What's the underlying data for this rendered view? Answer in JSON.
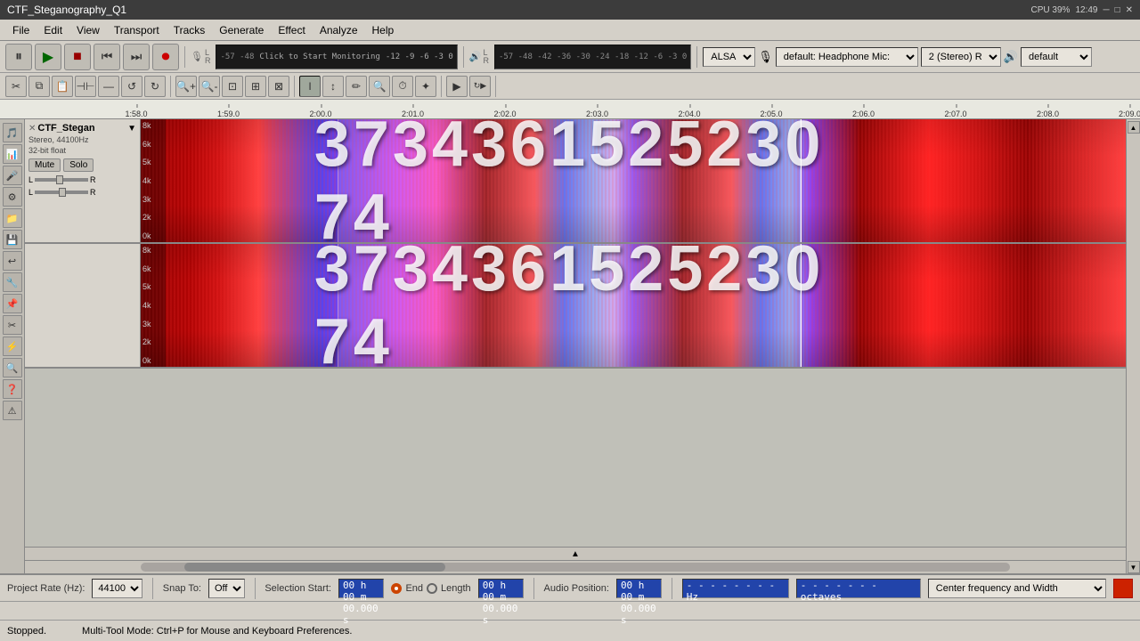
{
  "titlebar": {
    "title": "CTF_Steganography_Q1",
    "cpu": "CPU 39%",
    "time": "12:49"
  },
  "menubar": {
    "items": [
      "File",
      "Edit",
      "View",
      "Transport",
      "Tracks",
      "Generate",
      "Effect",
      "Analyze",
      "Help"
    ]
  },
  "transport": {
    "pause_label": "⏸",
    "play_label": "▶",
    "stop_label": "⏹",
    "prev_label": "⏮",
    "next_label": "⏭",
    "record_label": "⏺"
  },
  "vu": {
    "input_levels": "-57  -48",
    "monitoring": "Click to Start Monitoring",
    "scale": "-12 -9 -6 -3 0",
    "output_levels": "-57  -48  -42  -36  -30  -24  -18  -12  -6  -3 0",
    "input_icon": "🎙",
    "output_icon": "🔊"
  },
  "devices": {
    "driver": "ALSA",
    "input": "default: Headphone Mic:",
    "channels": "2 (Stereo) R",
    "output": "default"
  },
  "tools": {
    "selection": "I",
    "envelope": "↕",
    "draw": "✏",
    "zoom": "🔍",
    "time": "⏱",
    "multi": "✦"
  },
  "ruler": {
    "ticks": [
      "1:58.0",
      "1:59.0",
      "2:00.0",
      "2:01.0",
      "2:02.0",
      "2:03.0",
      "2:04.0",
      "2:05.0",
      "2:06.0",
      "2:07.0",
      "2:08.0",
      "2:09.0"
    ]
  },
  "track": {
    "name": "CTF_Stegan",
    "info1": "Stereo, 44100Hz",
    "info2": "32-bit float",
    "mute": "Mute",
    "solo": "Solo",
    "numbers": "3734361525230 74",
    "freq_labels": [
      "8k",
      "6k",
      "5k",
      "4k",
      "3k",
      "2k",
      "0k"
    ]
  },
  "statusbar": {
    "project_rate_label": "Project Rate (Hz):",
    "project_rate_value": "44100",
    "snap_label": "Snap To:",
    "snap_value": "Off",
    "sel_start_label": "Selection Start:",
    "sel_start_value": "00 h 00 m 00.000 s",
    "end_label": "End",
    "length_label": "Length",
    "sel_end_value": "00 h 00 m 00.000 s",
    "audio_pos_label": "Audio Position:",
    "audio_pos_value": "00 h 00 m 00.000 s",
    "cf_label": "Center frequency and Width",
    "cf_dropdown": "Center frequency and Width",
    "freq_value": "- - - - - - - - Hz",
    "octaves_value": "- - - - - - - octaves",
    "selection_label": "Selection",
    "stopped_label": "Stopped.",
    "hint": "Multi-Tool Mode: Ctrl+P for Mouse and Keyboard Preferences."
  }
}
